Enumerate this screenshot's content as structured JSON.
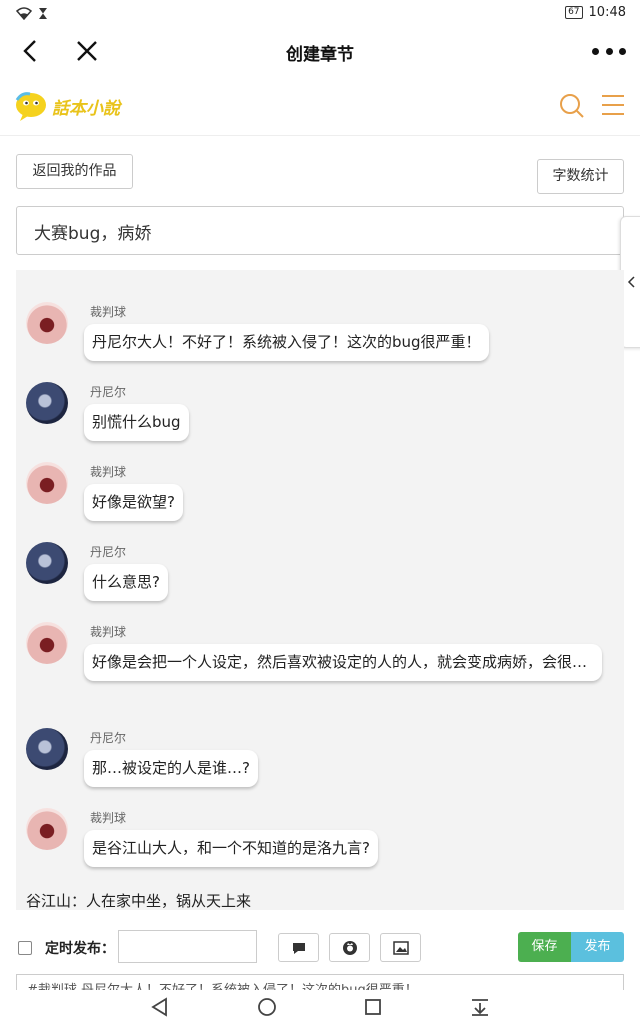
{
  "status_bar": {
    "battery": "67",
    "time": "10:48"
  },
  "title_bar": {
    "title": "创建章节"
  },
  "site": {
    "logo_text": "話本小說",
    "accent_color": "#e8a04a"
  },
  "buttons": {
    "back_to_works": "返回我的作品",
    "word_count": "字数统计"
  },
  "chapter_title": "大赛bug，病娇",
  "messages": [
    {
      "speaker": "裁判球",
      "avatar": "red",
      "text": "丹尼尔大人！不好了！系统被入侵了！这次的bug很严重！"
    },
    {
      "speaker": "丹尼尔",
      "avatar": "dark",
      "text": "别慌什么bug"
    },
    {
      "speaker": "裁判球",
      "avatar": "red",
      "text": "好像是欲望?"
    },
    {
      "speaker": "丹尼尔",
      "avatar": "dark",
      "text": "什么意思?"
    },
    {
      "speaker": "裁判球",
      "avatar": "red",
      "text": "好像是会把一个人设定，然后喜欢被设定的人的人，就会变成病娇，会很…"
    },
    {
      "speaker": "丹尼尔",
      "avatar": "dark",
      "text": "那…被设定的人是谁…?"
    },
    {
      "speaker": "裁判球",
      "avatar": "red",
      "text": "是谷江山大人，和一个不知道的是洛九言?"
    }
  ],
  "narration": "谷江山：人在家中坐，锅从天上来",
  "toolbar": {
    "schedule_label": "定时发布：",
    "schedule_value": "",
    "save": "保存",
    "publish": "发布",
    "save_color": "#4caf50",
    "publish_color": "#5bc0de"
  },
  "preview_text": "#裁判球 丹尼尔大人！不好了！系统被入侵了！这次的bug很严重！"
}
